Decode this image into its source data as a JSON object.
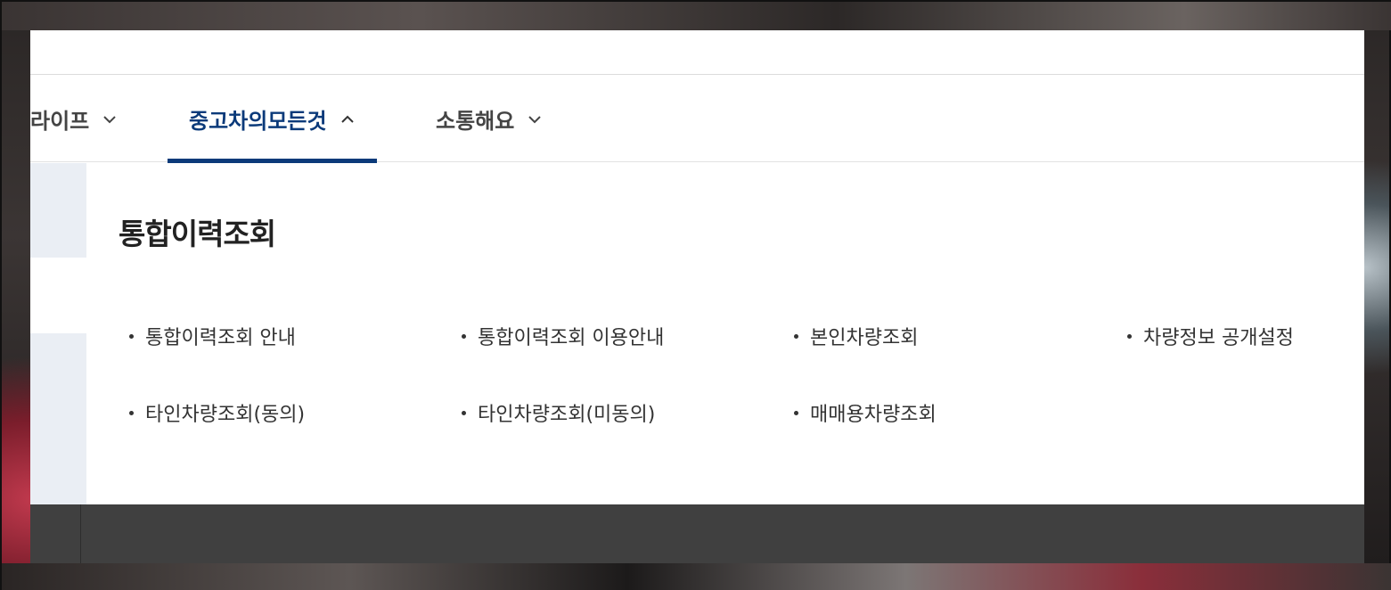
{
  "nav": {
    "items": [
      {
        "label": "라이프",
        "state": "collapsed"
      },
      {
        "label": "중고차의모든것",
        "state": "expanded"
      },
      {
        "label": "소통해요",
        "state": "collapsed"
      }
    ]
  },
  "submenu": {
    "title": "통합이력조회",
    "links": [
      "통합이력조회 안내",
      "통합이력조회 이용안내",
      "본인차량조회",
      "차량정보 공개설정",
      "타인차량조회(동의)",
      "타인차량조회(미동의)",
      "매매용차량조회"
    ]
  },
  "colors": {
    "accent": "#0b3a7a",
    "side_block": "#eaeef4",
    "footer": "#404040"
  },
  "icons": {
    "collapsed": "chevron-down-icon",
    "expanded": "chevron-up-icon"
  }
}
